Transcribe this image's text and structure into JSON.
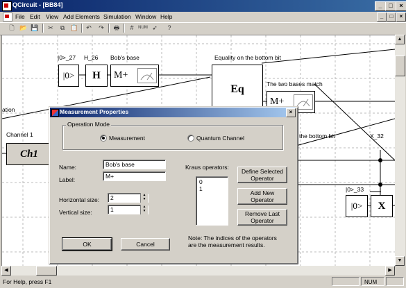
{
  "app": {
    "title": "QCircuit - [BB84]"
  },
  "menu": {
    "items": [
      "File",
      "Edit",
      "View",
      "Add Elements",
      "Simulation",
      "Window",
      "Help"
    ]
  },
  "toolbar": {
    "buttons": [
      "new-icon",
      "open-icon",
      "save-icon",
      "cut-icon",
      "copy-icon",
      "paste-icon",
      "undo-icon",
      "redo-icon",
      "print-icon",
      "grid-icon",
      "numbering-icon",
      "pointer-icon",
      "help-icon"
    ]
  },
  "circuit": {
    "labels": {
      "zero27": "|0>_27",
      "h26": "H_26",
      "bobs_base": "Bob's base",
      "equality_top": "Equality on the bottom bit",
      "two_bases": "The two bases match",
      "channel1": "Channel 1",
      "ation": "ation",
      "bottom_bit": "the bottom bit",
      "x32": "X_32",
      "zero33": "|0>_33"
    },
    "gates": {
      "ket0": "|0>",
      "h": "H",
      "mplus": "M+",
      "eq": "Eq",
      "ch1": "Ch1",
      "x": "X"
    }
  },
  "dialog": {
    "title": "Measurement Properties",
    "operation_mode": "Operation Mode",
    "measurement": "Measurement",
    "quantum_channel": "Quantum Channel",
    "name_label": "Name:",
    "name_value": "Bob's base",
    "label_label": "Label:",
    "label_value": "M+",
    "hsize_label": "Horizontal size:",
    "hsize_value": "2",
    "vsize_label": "Vertical size:",
    "vsize_value": "1",
    "kraus_label": "Kraus operators:",
    "kraus_items": [
      "0",
      "1"
    ],
    "define_selected": "Define Selected Operator",
    "add_new": "Add New Operator",
    "remove_last": "Remove Last Operator",
    "note": "Note: The indices of the operators are the measurement results.",
    "ok": "OK",
    "cancel": "Cancel"
  },
  "status": {
    "text": "For Help, press F1",
    "num": "NUM"
  }
}
